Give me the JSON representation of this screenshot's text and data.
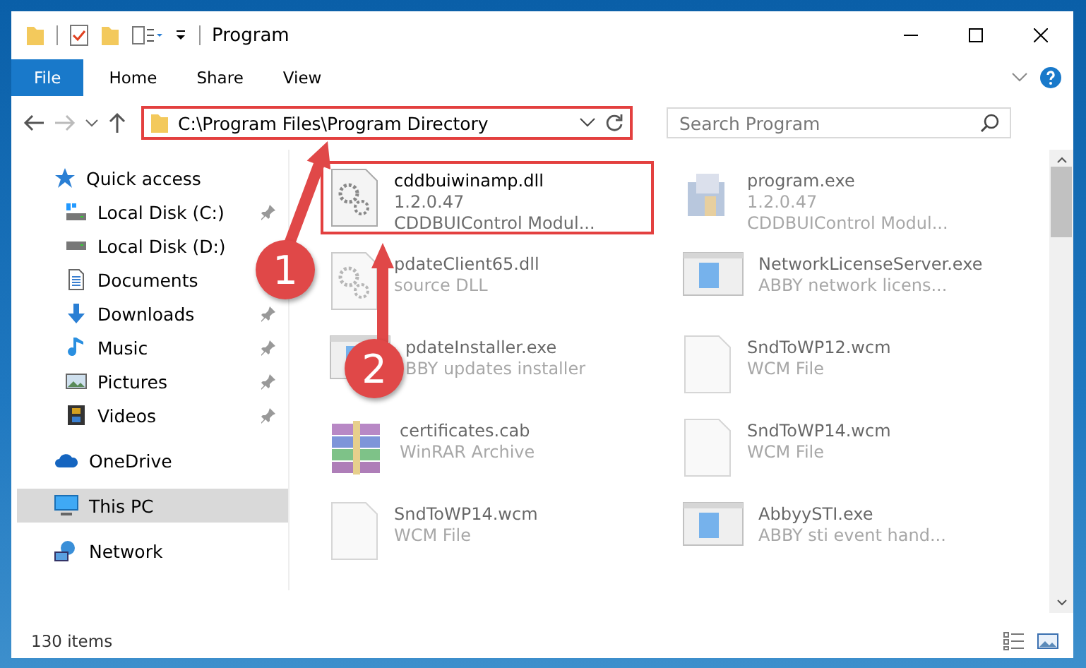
{
  "window": {
    "title": "Program"
  },
  "ribbon": {
    "tabs": [
      {
        "label": "File",
        "kind": "file"
      },
      {
        "label": "Home",
        "kind": "tab"
      },
      {
        "label": "Share",
        "kind": "tab"
      },
      {
        "label": "View",
        "kind": "tab"
      }
    ]
  },
  "address": {
    "path": "C:\\Program Files\\Program Directory",
    "highlighted": true
  },
  "search": {
    "placeholder": "Search Program"
  },
  "sidebar": {
    "items": [
      {
        "label": "Quick access",
        "kind": "star",
        "selected": false,
        "children": [
          {
            "label": "Local Disk (C:)",
            "kind": "system",
            "pinned": true,
            "selected": false
          },
          {
            "label": "Local Disk (D:)",
            "kind": "drive",
            "pinned": false,
            "selected": false
          },
          {
            "label": "Documents",
            "kind": "documents",
            "pinned": false,
            "selected": false
          },
          {
            "label": "Downloads",
            "kind": "downloads",
            "pinned": true,
            "selected": false
          },
          {
            "label": "Music",
            "kind": "music",
            "pinned": true,
            "selected": false
          },
          {
            "label": "Pictures",
            "kind": "pictures",
            "pinned": true,
            "selected": false
          },
          {
            "label": "Videos",
            "kind": "videos",
            "pinned": true,
            "selected": false
          }
        ]
      },
      {
        "label": "OneDrive",
        "kind": "cloud",
        "selected": false
      },
      {
        "label": "This PC",
        "kind": "pc",
        "selected": true
      },
      {
        "label": "Network",
        "kind": "network",
        "selected": false
      }
    ]
  },
  "files": [
    {
      "name": "cddbuiwinamp.dll",
      "details": [
        "1.2.0.47",
        "CDDBUIControl Modul..."
      ],
      "kind": "dll",
      "blurred": false,
      "highlighted": true
    },
    {
      "name": "program.exe",
      "details": [
        "1.2.0.47",
        "CDDBUIControl Modul..."
      ],
      "kind": "setup",
      "blurred": true,
      "highlighted": false
    },
    {
      "name": "pdateClient65.dll",
      "details": [
        "source DLL"
      ],
      "kind": "dll",
      "blurred": true,
      "highlighted": false
    },
    {
      "name": "NetworkLicenseServer.exe",
      "details": [
        "ABBY network licens..."
      ],
      "kind": "app",
      "blurred": true,
      "highlighted": false
    },
    {
      "name": "pdateInstaller.exe",
      "details": [
        "BBY updates installer"
      ],
      "kind": "app",
      "blurred": true,
      "highlighted": false
    },
    {
      "name": "SndToWP12.wcm",
      "details": [
        "WCM File"
      ],
      "kind": "file",
      "blurred": true,
      "highlighted": false
    },
    {
      "name": "certificates.cab",
      "details": [
        "WinRAR Archive"
      ],
      "kind": "archive",
      "blurred": true,
      "highlighted": false
    },
    {
      "name": "SndToWP14.wcm",
      "details": [
        "WCM File"
      ],
      "kind": "file",
      "blurred": true,
      "highlighted": false
    },
    {
      "name": "SndToWP14.wcm",
      "details": [
        "WCM File"
      ],
      "kind": "file",
      "blurred": true,
      "highlighted": false
    },
    {
      "name": "AbbyySTI.exe",
      "details": [
        "ABBY sti event hand..."
      ],
      "kind": "app",
      "blurred": true,
      "highlighted": false
    }
  ],
  "status_bar": {
    "count": "130 items"
  },
  "annotations": [
    {
      "label": "1"
    },
    {
      "label": "2"
    }
  ]
}
